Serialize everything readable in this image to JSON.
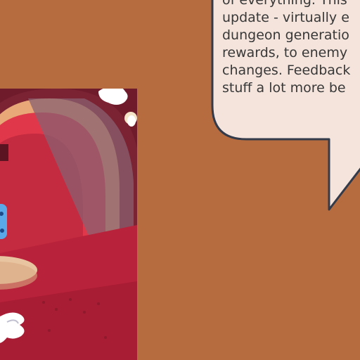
{
  "scene": {
    "background_color": "#b76c3f",
    "speech_bubble": {
      "fill": "#f4e4dc",
      "outline": "#333a4a",
      "lines": [
        "of everything. This",
        "update - virtually e",
        "dungeon generatio",
        "rewards, to enemy",
        "changes. Feedback",
        "stuff a lot more be"
      ]
    },
    "artwork": {
      "description_icon": "dungeon-archway-artwork",
      "colors": {
        "wall": "#6f1b2b",
        "arch_outer": "#e8a878",
        "arch_red": "#e0384a",
        "floor": "#b8223a",
        "table": "#e8c4a0",
        "crystal": "#5aa8e8"
      }
    }
  }
}
